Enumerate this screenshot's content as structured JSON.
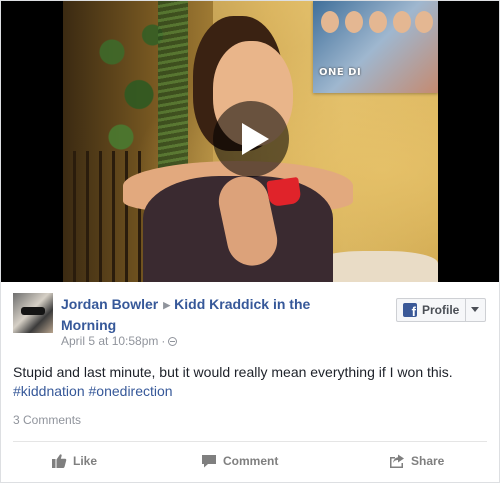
{
  "video": {
    "poster_text": "ONE DI",
    "icons": {
      "play": "play-icon"
    }
  },
  "post": {
    "author": "Jordan Bowler",
    "target": "Kidd Kraddick in the Morning",
    "timestamp": "April 5 at 10:58pm",
    "timestamp_separator": "·",
    "privacy_icon": "globe-icon",
    "text": "Stupid and last minute, but it would really mean everything if I won this.",
    "hashtags": [
      "#kiddnation",
      "#onedirection"
    ],
    "comments_count": "3 Comments"
  },
  "profile_button": {
    "label": "Profile",
    "icon": "facebook-icon"
  },
  "actions": {
    "like": "Like",
    "comment": "Comment",
    "share": "Share"
  },
  "colors": {
    "link": "#365899",
    "meta": "#90949c",
    "text": "#1d2129",
    "action": "#7f7f7f",
    "facebook_blue": "#3b5998"
  }
}
